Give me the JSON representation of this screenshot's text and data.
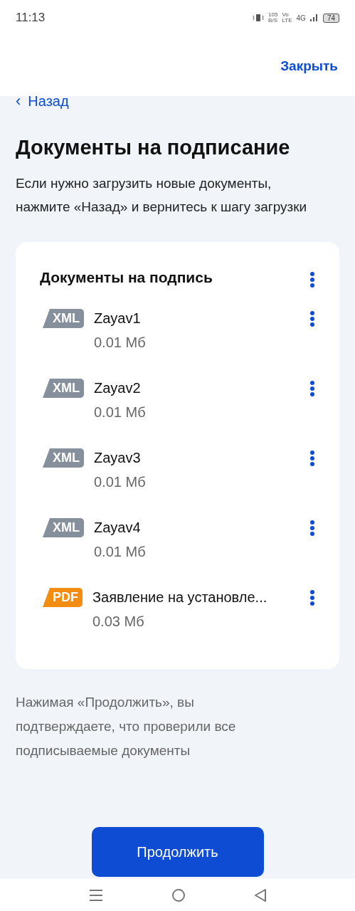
{
  "status_bar": {
    "time": "11:13",
    "speed": "105",
    "speed_unit": "B/S",
    "volte_top": "Vo",
    "volte_bottom": "LTE",
    "network": "4G",
    "battery": "74"
  },
  "header": {
    "close": "Закрыть"
  },
  "back": {
    "arrow": "‹",
    "label": "Назад"
  },
  "title": "Документы на подписание",
  "description": "Если нужно загрузить новые документы, нажмите «Назад» и вернитесь к шагу загрузки",
  "card": {
    "title": "Документы на подпись",
    "documents": [
      {
        "kind": "xml",
        "badge": "XML",
        "name": "Zayav1",
        "size": "0.01 Мб"
      },
      {
        "kind": "xml",
        "badge": "XML",
        "name": "Zayav2",
        "size": "0.01 Мб"
      },
      {
        "kind": "xml",
        "badge": "XML",
        "name": "Zayav3",
        "size": "0.01 Мб"
      },
      {
        "kind": "xml",
        "badge": "XML",
        "name": "Zayav4",
        "size": "0.01 Мб"
      },
      {
        "kind": "pdf",
        "badge": "PDF",
        "name": "Заявление на установле...",
        "size": "0.03 Мб"
      }
    ]
  },
  "notice": "Нажимая «Продолжить», вы подтверждаете, что проверили все подписываемые документы",
  "continue_button": "Продолжить"
}
